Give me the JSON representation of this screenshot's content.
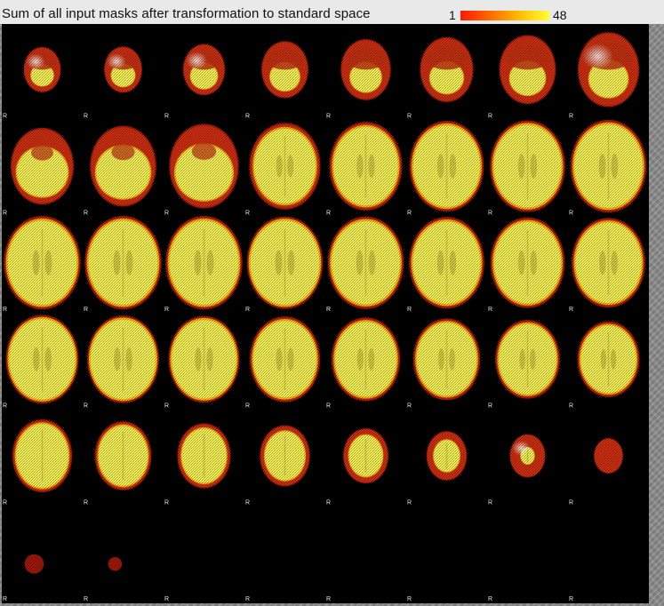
{
  "title": "Sum of all input masks after transformation to standard space",
  "colorbar": {
    "min_label": "1",
    "max_label": "48",
    "colors": [
      "#ff1a00",
      "#ff6a00",
      "#ffbf00",
      "#ffff33"
    ]
  },
  "orientation_label": "R",
  "grid": {
    "rows": 6,
    "cols": 8
  },
  "slices": [
    {
      "size": 0.46,
      "core": 0.42,
      "kind": "lower",
      "white": true
    },
    {
      "size": 0.47,
      "core": 0.44,
      "kind": "lower",
      "white": true
    },
    {
      "size": 0.52,
      "core": 0.5,
      "kind": "lower",
      "white": true
    },
    {
      "size": 0.58,
      "core": 0.55,
      "kind": "lower",
      "white": false
    },
    {
      "size": 0.62,
      "core": 0.58,
      "kind": "lower",
      "white": false
    },
    {
      "size": 0.66,
      "core": 0.62,
      "kind": "lower",
      "white": false
    },
    {
      "size": 0.7,
      "core": 0.66,
      "kind": "lower",
      "white": false
    },
    {
      "size": 0.76,
      "core": 0.72,
      "kind": "lower",
      "white": true
    },
    {
      "size": 0.78,
      "core": 0.66,
      "kind": "mid",
      "white": false
    },
    {
      "size": 0.82,
      "core": 0.7,
      "kind": "mid",
      "white": false
    },
    {
      "size": 0.86,
      "core": 0.74,
      "kind": "mid",
      "white": false
    },
    {
      "size": 0.88,
      "core": 0.8,
      "kind": "upper",
      "white": false
    },
    {
      "size": 0.9,
      "core": 0.84,
      "kind": "upper",
      "white": false
    },
    {
      "size": 0.92,
      "core": 0.87,
      "kind": "upper",
      "white": false
    },
    {
      "size": 0.93,
      "core": 0.88,
      "kind": "upper",
      "white": false
    },
    {
      "size": 0.94,
      "core": 0.89,
      "kind": "upper",
      "white": false
    },
    {
      "size": 0.95,
      "core": 0.9,
      "kind": "upper",
      "white": false
    },
    {
      "size": 0.95,
      "core": 0.9,
      "kind": "upper",
      "white": false
    },
    {
      "size": 0.95,
      "core": 0.9,
      "kind": "upper",
      "white": false
    },
    {
      "size": 0.94,
      "core": 0.9,
      "kind": "upper",
      "white": false
    },
    {
      "size": 0.94,
      "core": 0.89,
      "kind": "upper",
      "white": false
    },
    {
      "size": 0.93,
      "core": 0.88,
      "kind": "upper",
      "white": false
    },
    {
      "size": 0.92,
      "core": 0.87,
      "kind": "upper",
      "white": false
    },
    {
      "size": 0.91,
      "core": 0.86,
      "kind": "upper",
      "white": false
    },
    {
      "size": 0.9,
      "core": 0.86,
      "kind": "upper",
      "white": false
    },
    {
      "size": 0.89,
      "core": 0.85,
      "kind": "upper",
      "white": false
    },
    {
      "size": 0.88,
      "core": 0.84,
      "kind": "upper",
      "white": false
    },
    {
      "size": 0.87,
      "core": 0.82,
      "kind": "upper",
      "white": false
    },
    {
      "size": 0.85,
      "core": 0.8,
      "kind": "upper",
      "white": false
    },
    {
      "size": 0.83,
      "core": 0.78,
      "kind": "upper",
      "white": false
    },
    {
      "size": 0.8,
      "core": 0.75,
      "kind": "upper",
      "white": false
    },
    {
      "size": 0.77,
      "core": 0.72,
      "kind": "upper",
      "white": false
    },
    {
      "size": 0.74,
      "core": 0.68,
      "kind": "top",
      "white": false
    },
    {
      "size": 0.7,
      "core": 0.64,
      "kind": "top",
      "white": false
    },
    {
      "size": 0.66,
      "core": 0.58,
      "kind": "top",
      "white": false
    },
    {
      "size": 0.62,
      "core": 0.52,
      "kind": "top",
      "white": false
    },
    {
      "size": 0.56,
      "core": 0.44,
      "kind": "top",
      "white": false
    },
    {
      "size": 0.5,
      "core": 0.34,
      "kind": "top",
      "white": false
    },
    {
      "size": 0.44,
      "core": 0.18,
      "kind": "top",
      "white": true
    },
    {
      "size": 0.36,
      "core": 0.0,
      "kind": "top",
      "white": false
    },
    {
      "size": 0.28,
      "core": 0.0,
      "kind": "speck",
      "white": false
    },
    {
      "size": 0.2,
      "core": 0.0,
      "kind": "speck",
      "white": false
    },
    {
      "size": 0.0,
      "core": 0.0,
      "kind": "empty",
      "white": false
    },
    {
      "size": 0.0,
      "core": 0.0,
      "kind": "empty",
      "white": false
    },
    {
      "size": 0.0,
      "core": 0.0,
      "kind": "empty",
      "white": false
    },
    {
      "size": 0.0,
      "core": 0.0,
      "kind": "empty",
      "white": false
    },
    {
      "size": 0.0,
      "core": 0.0,
      "kind": "empty",
      "white": false
    },
    {
      "size": 0.0,
      "core": 0.0,
      "kind": "empty",
      "white": false
    }
  ]
}
